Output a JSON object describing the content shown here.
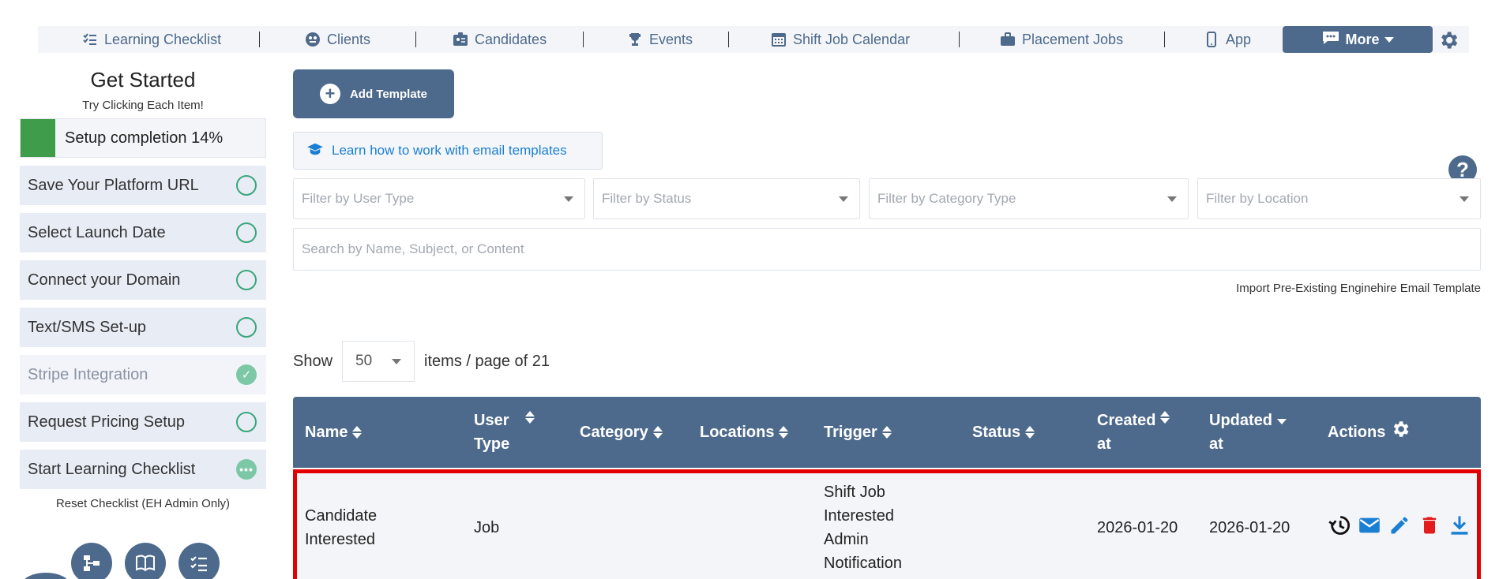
{
  "nav": {
    "items": [
      {
        "label": "Learning Checklist",
        "icon": "checklist-icon"
      },
      {
        "label": "Clients",
        "icon": "clients-icon"
      },
      {
        "label": "Candidates",
        "icon": "candidates-icon"
      },
      {
        "label": "Events",
        "icon": "trophy-icon"
      },
      {
        "label": "Shift Job Calendar",
        "icon": "calendar-icon"
      },
      {
        "label": "Placement Jobs",
        "icon": "briefcase-icon"
      },
      {
        "label": "App",
        "icon": "mobile-icon"
      }
    ],
    "more_label": "More"
  },
  "sidebar": {
    "title": "Get Started",
    "subtitle": "Try Clicking Each Item!",
    "completion_label": "Setup completion 14%",
    "completion_pct": 14,
    "items": [
      {
        "label": "Save Your Platform URL",
        "state": "todo"
      },
      {
        "label": "Select Launch Date",
        "state": "todo"
      },
      {
        "label": "Connect your Domain",
        "state": "todo"
      },
      {
        "label": "Text/SMS Set-up",
        "state": "todo"
      },
      {
        "label": "Stripe Integration",
        "state": "done"
      },
      {
        "label": "Request Pricing Setup",
        "state": "todo"
      },
      {
        "label": "Start Learning Checklist",
        "state": "in-progress"
      }
    ],
    "reset_label": "Reset Checklist (EH Admin Only)"
  },
  "main": {
    "add_template_label": "Add Template",
    "learn_link": "Learn how to work with email templates",
    "filters": {
      "user_type": "Filter by User Type",
      "status": "Filter by Status",
      "category_type": "Filter by Category Type",
      "location": "Filter by Location"
    },
    "search_placeholder": "Search by Name, Subject, or Content",
    "import_link": "Import Pre-Existing Enginehire Email Template",
    "show_label": "Show",
    "per_page": "50",
    "per_page_suffix": "items / page of 21"
  },
  "table": {
    "columns": {
      "name": "Name",
      "user_type_1": "User",
      "user_type_2": "Type",
      "category": "Category",
      "locations": "Locations",
      "trigger": "Trigger",
      "status": "Status",
      "created_1": "Created",
      "created_2": "at",
      "updated_1": "Updated",
      "updated_2": "at",
      "actions": "Actions"
    },
    "rows": [
      {
        "name_1": "Candidate",
        "name_2": "Interested",
        "user_type": "Job",
        "category": "",
        "locations": "",
        "trigger_1": "Shift Job",
        "trigger_2": "Interested",
        "trigger_3": "Admin",
        "trigger_4": "Notification",
        "status": "",
        "created_at": "2026-01-20",
        "updated_at": "2026-01-20"
      }
    ]
  },
  "colors": {
    "primary": "#4d6a8c",
    "link": "#1b7fd4",
    "success": "#3f9c4a",
    "highlight": "#e30000",
    "danger": "#e31b1b"
  }
}
